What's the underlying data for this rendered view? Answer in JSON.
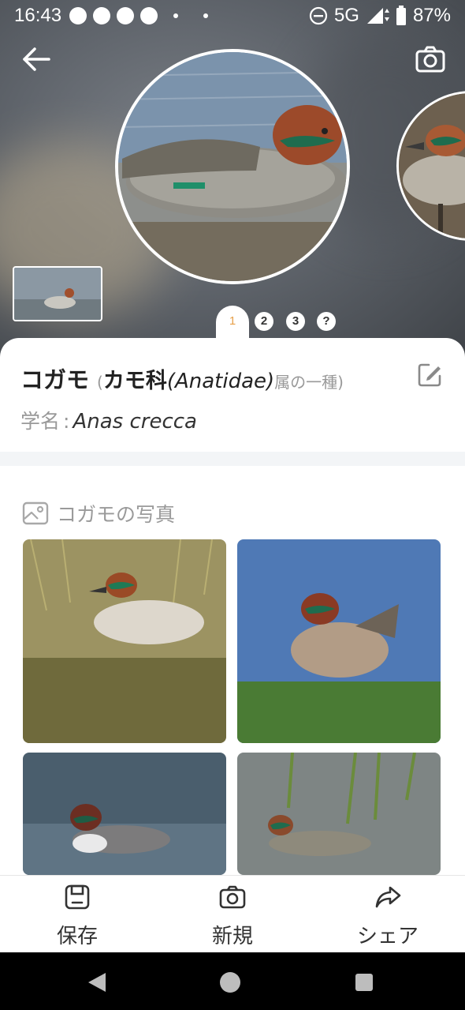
{
  "status_bar": {
    "time": "16:43",
    "network": "5G",
    "battery": "87%"
  },
  "hero": {
    "pager": [
      "1",
      "2",
      "3",
      "?"
    ],
    "active_page": 0
  },
  "species": {
    "name": "コガモ",
    "paren_open": "(",
    "family_jp": "カモ科",
    "family_latin": "(Anatidae)",
    "genus_note": "属の一種)",
    "sci_label": "学名",
    "sci_colon": ":",
    "sci_name": "Anas crecca"
  },
  "photos": {
    "title": "コガモの写真"
  },
  "bottom_bar": {
    "save": "保存",
    "new": "新規",
    "share": "シェア"
  },
  "colors": {
    "accent": "#e7a04a",
    "divider": "#f3f5f7",
    "muted_text": "#999999"
  }
}
